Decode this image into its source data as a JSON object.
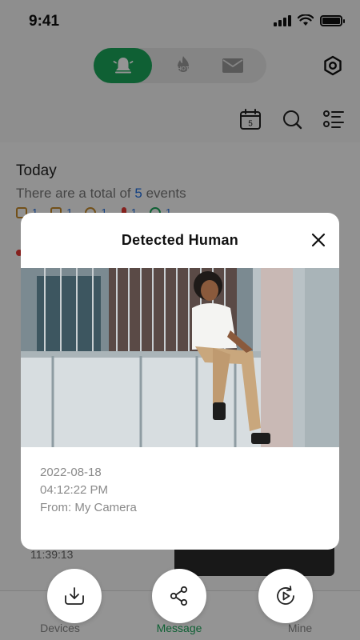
{
  "status_bar": {
    "time": "9:41"
  },
  "header": {
    "segments": [
      {
        "icon": "bell-icon",
        "active": true
      },
      {
        "icon": "hot-icon",
        "label": "HOT"
      },
      {
        "icon": "mail-icon"
      }
    ],
    "settings_icon": "settings-hexagon-icon"
  },
  "toolbar": {
    "calendar_day": "5",
    "icons": [
      "calendar-icon",
      "search-icon",
      "list-icon"
    ]
  },
  "summary": {
    "title": "Today",
    "total_prefix": "There are a total of ",
    "total_count": "5",
    "total_suffix": " events",
    "type_counts": [
      "1",
      "1",
      "1",
      "1",
      "1"
    ]
  },
  "background_event": {
    "time": "11:39:13"
  },
  "modal": {
    "title": "Detected Human",
    "date": "2022-08-18",
    "time": "04:12:22 PM",
    "source": "From: My Camera"
  },
  "actions": [
    {
      "icon": "download-icon"
    },
    {
      "icon": "share-icon"
    },
    {
      "icon": "replay-icon"
    }
  ],
  "bottom_nav": {
    "items": [
      {
        "label": "Devices",
        "active": false
      },
      {
        "label": "Message",
        "active": true
      },
      {
        "label": "Mine",
        "active": false
      }
    ]
  },
  "colors": {
    "accent": "#1aa55a",
    "count_blue": "#1f6fe0"
  }
}
